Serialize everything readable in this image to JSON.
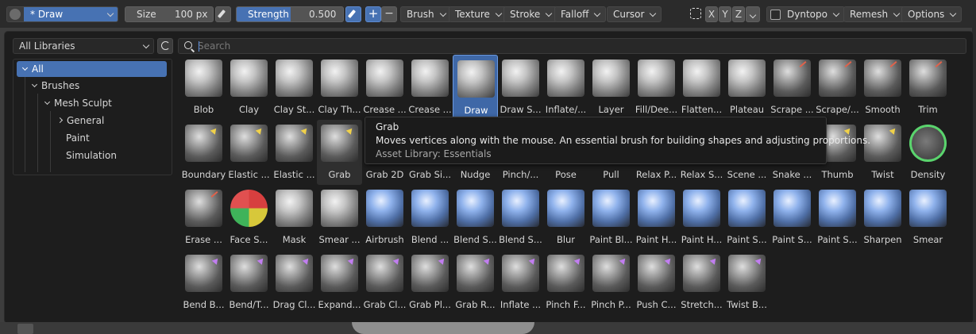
{
  "toolbar": {
    "brush_name": "* Draw",
    "size_label": "Size",
    "size_value": "100 px",
    "strength_label": "Strength",
    "strength_value": "0.500",
    "plus": "+",
    "minus": "−",
    "menus": [
      "Brush",
      "Texture",
      "Stroke",
      "Falloff",
      "Cursor"
    ],
    "axes": [
      "X",
      "Y",
      "Z"
    ],
    "dyntopo": "Dyntopo",
    "remesh": "Remesh",
    "options": "Options",
    "accent": "#4772b3"
  },
  "library": {
    "selected": "All Libraries",
    "tree": [
      "All",
      "Brushes",
      "Mesh Sculpt",
      "General",
      "Paint",
      "Simulation"
    ]
  },
  "search": {
    "placeholder": "Search",
    "value": ""
  },
  "brushes": [
    [
      "Blob",
      "Clay",
      "Clay St...",
      "Clay Th...",
      "Crease ...",
      "Crease ...",
      "Draw",
      "Draw S...",
      "Inflate/...",
      "Layer",
      "Fill/Dee...",
      "Flatten...",
      "Plateau",
      "Scrape ...",
      "Scrape/...",
      "Smooth",
      "Trim"
    ],
    [
      "Boundary",
      "Elastic ...",
      "Elastic ...",
      "Grab",
      "Grab 2D",
      "Grab Si...",
      "Nudge",
      "Pinch/...",
      "Pose",
      "Pull",
      "Relax P...",
      "Relax S...",
      "Scene ...",
      "Snake ...",
      "Thumb",
      "Twist",
      "Density"
    ],
    [
      "Erase ...",
      "Face S...",
      "Mask",
      "Smear ...",
      "Airbrush",
      "Blend ...",
      "Blend S...",
      "Blend S...",
      "Blur",
      "Paint Bl...",
      "Paint H...",
      "Paint H...",
      "Paint S...",
      "Paint S...",
      "Paint S...",
      "Sharpen",
      "Smear"
    ],
    [
      "Bend B...",
      "Bend/T...",
      "Drag Cl...",
      "Expand...",
      "Grab Cl...",
      "Grab Pl...",
      "Grab R...",
      "Inflate ...",
      "Pinch F...",
      "Pinch P...",
      "Push C...",
      "Stretch...",
      "Twist B..."
    ]
  ],
  "tooltip": {
    "title": "Grab",
    "description": "Moves vertices along with the mouse. An essential brush for building shapes and adjusting proportions.",
    "library": "Asset Library: Essentials"
  }
}
